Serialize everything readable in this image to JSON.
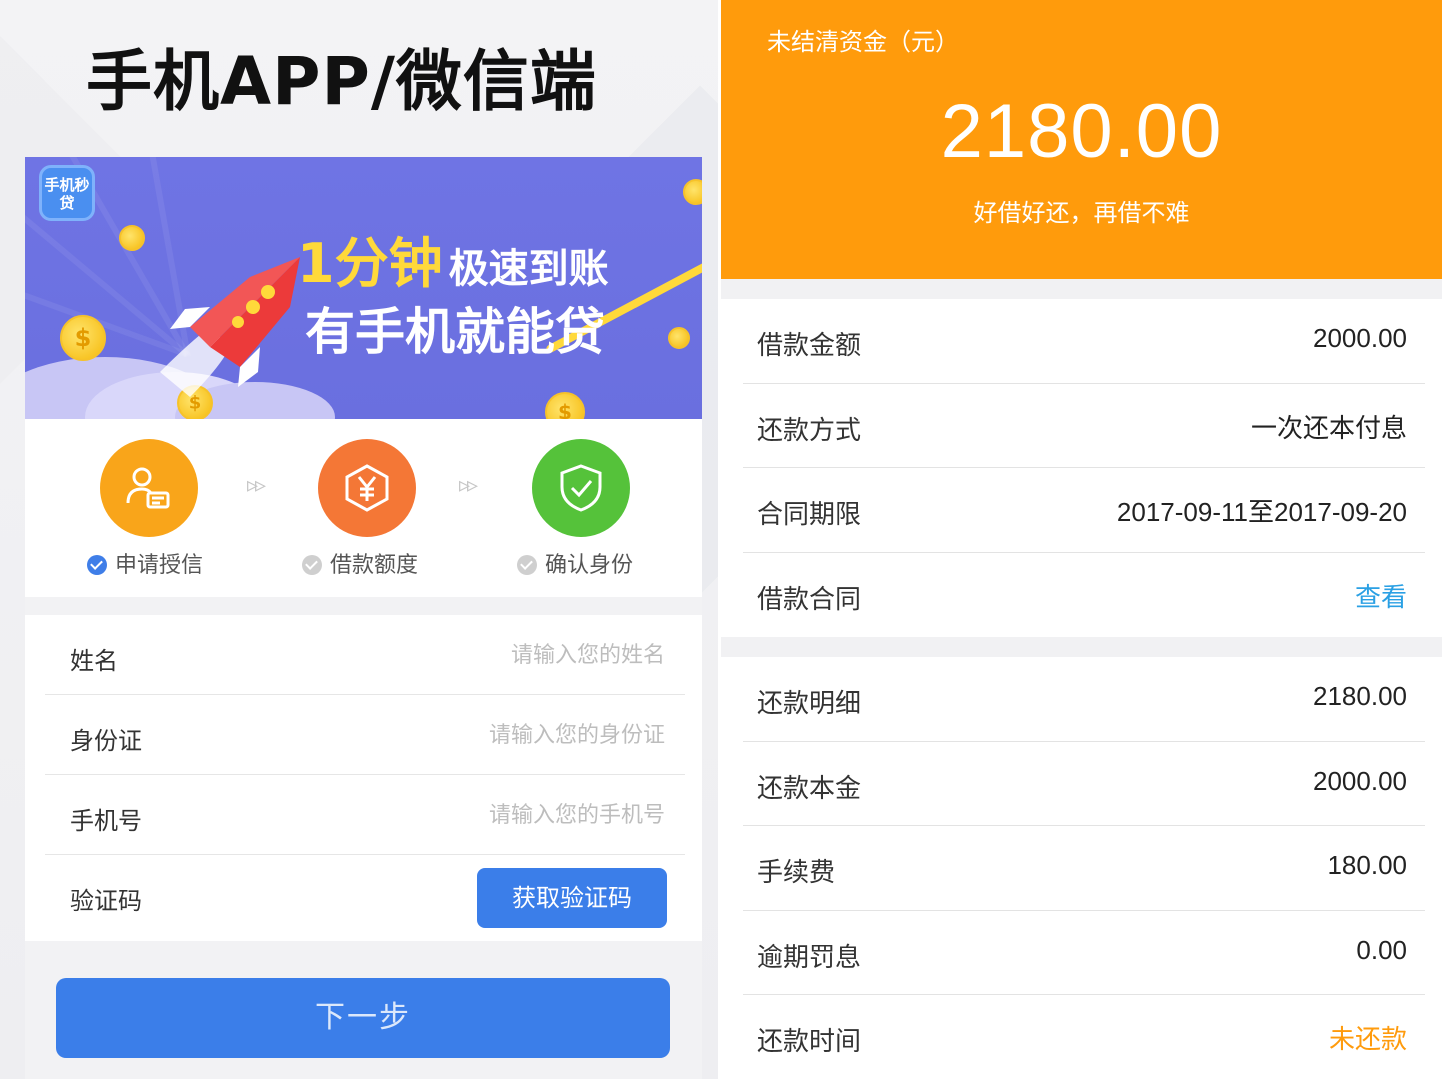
{
  "left": {
    "title": "手机APP/微信端",
    "banner": {
      "logo_text": "手机秒贷",
      "line1_big": "1分钟",
      "line1_small": "极速到账",
      "line2": "有手机就能贷",
      "coin_symbol": "$"
    },
    "steps": [
      {
        "label": "申请授信",
        "icon": "id-card-icon",
        "color": "#f9a51a",
        "checked": true
      },
      {
        "label": "借款额度",
        "icon": "yuan-hexagon-icon",
        "color": "#f47736",
        "checked": false
      },
      {
        "label": "确认身份",
        "icon": "shield-check-icon",
        "color": "#55c23a",
        "checked": false
      }
    ],
    "form": {
      "name_label": "姓名",
      "name_placeholder": "请输入您的姓名",
      "id_label": "身份证",
      "id_placeholder": "请输入您的身份证",
      "phone_label": "手机号",
      "phone_placeholder": "请输入您的手机号",
      "code_label": "验证码",
      "code_button": "获取验证码"
    },
    "next_button": "下一步"
  },
  "right": {
    "header": {
      "label": "未结清资金（元）",
      "amount": "2180.00",
      "slogan": "好借好还，再借不难"
    },
    "loan_info": [
      {
        "label": "借款金额",
        "value": "2000.00"
      },
      {
        "label": "还款方式",
        "value": "一次还本付息"
      },
      {
        "label": "合同期限",
        "value": "2017-09-11至2017-09-20"
      },
      {
        "label": "借款合同",
        "value": "查看"
      }
    ],
    "repay_info": [
      {
        "label": "还款明细",
        "value": "2180.00"
      },
      {
        "label": "还款本金",
        "value": "2000.00"
      },
      {
        "label": "手续费",
        "value": "180.00"
      },
      {
        "label": "逾期罚息",
        "value": "0.00"
      },
      {
        "label": "还款时间",
        "value": "未还款"
      }
    ],
    "colors": {
      "header": "#ff9b0c",
      "link": "#2aa0e4",
      "warn": "#ff9b0c"
    }
  }
}
